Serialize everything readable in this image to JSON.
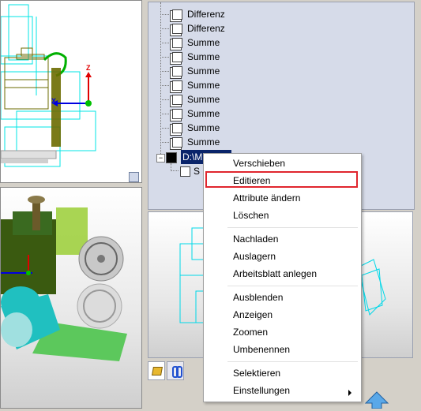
{
  "tree": {
    "items": [
      {
        "label": "Differenz"
      },
      {
        "label": "Differenz"
      },
      {
        "label": "Summe"
      },
      {
        "label": "Summe"
      },
      {
        "label": "Summe"
      },
      {
        "label": "Summe"
      },
      {
        "label": "Summe"
      },
      {
        "label": "Summe"
      },
      {
        "label": "Summe"
      },
      {
        "label": "Summe"
      }
    ],
    "selected_label": "D:\\M",
    "child_label": "S",
    "collapse_symbol": "−"
  },
  "context_menu": {
    "items": [
      {
        "label": "Verschieben"
      },
      {
        "label": "Editieren"
      },
      {
        "label": "Attribute ändern"
      },
      {
        "label": "Löschen"
      },
      {
        "label": "Nachladen"
      },
      {
        "label": "Auslagern"
      },
      {
        "label": "Arbeitsblatt anlegen"
      },
      {
        "label": "Ausblenden"
      },
      {
        "label": "Anzeigen"
      },
      {
        "label": "Zoomen"
      },
      {
        "label": "Umbenennen"
      },
      {
        "label": "Selektieren"
      },
      {
        "label": "Einstellungen"
      }
    ],
    "highlight_color": "#e0262e"
  },
  "axes": {
    "z_label": "Z",
    "x_label": "X"
  },
  "colors": {
    "selection_bg": "#0a246a",
    "tree_bg": "#d6dbe9"
  }
}
